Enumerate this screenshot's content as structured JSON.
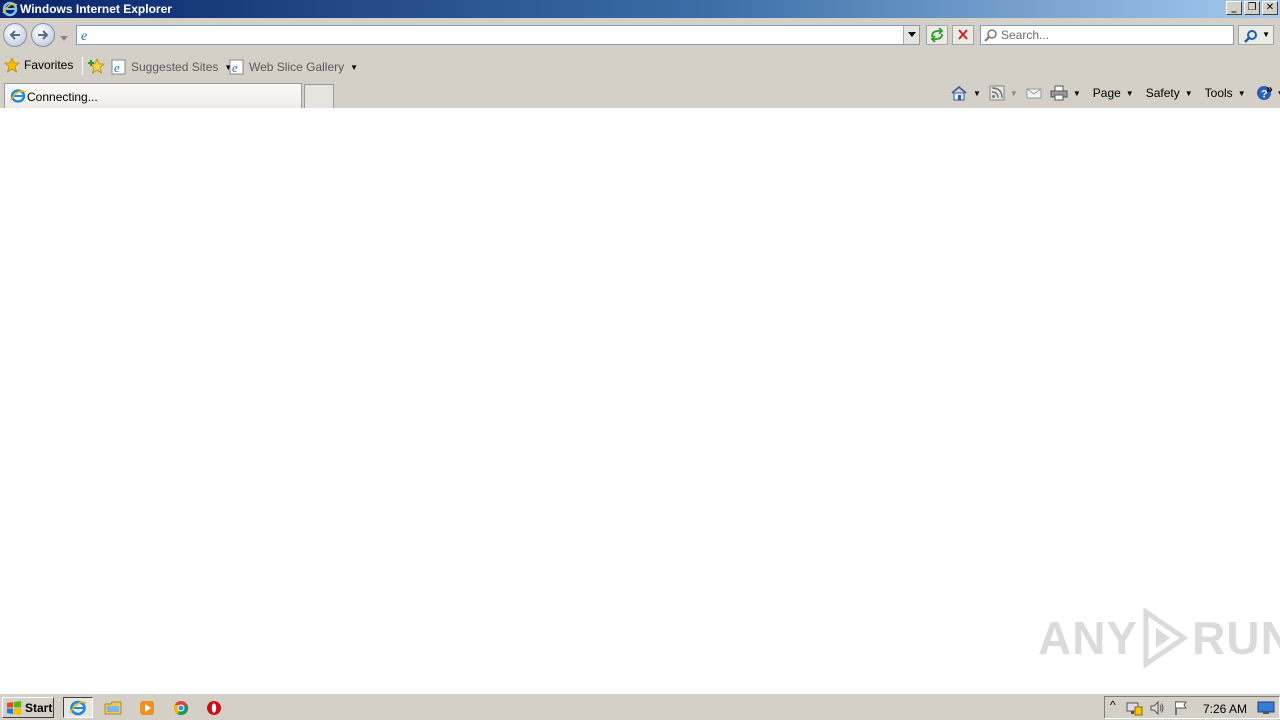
{
  "window": {
    "title": "Windows Internet Explorer",
    "controls": [
      "minimize",
      "restore",
      "close"
    ]
  },
  "address_bar": {
    "value": "",
    "icon": "ie-page-icon"
  },
  "search": {
    "placeholder": "Search..."
  },
  "favorites_bar": {
    "favorites_label": "Favorites",
    "links": [
      {
        "label": "Suggested Sites"
      },
      {
        "label": "Web Slice Gallery"
      }
    ]
  },
  "tabs": [
    {
      "label": "Connecting..."
    }
  ],
  "command_bar": {
    "page_label": "Page",
    "safety_label": "Safety",
    "tools_label": "Tools"
  },
  "watermark": {
    "text_left": "ANY",
    "text_right": "RUN"
  },
  "taskbar": {
    "start_label": "Start",
    "items": [
      "internet-explorer",
      "file-explorer",
      "media-player",
      "chrome",
      "opera"
    ],
    "clock": "7:26 AM"
  },
  "colors": {
    "title_gradient_start": "#0a246a",
    "title_gradient_end": "#a6caf0",
    "chrome_bg": "#d4d0c8"
  }
}
